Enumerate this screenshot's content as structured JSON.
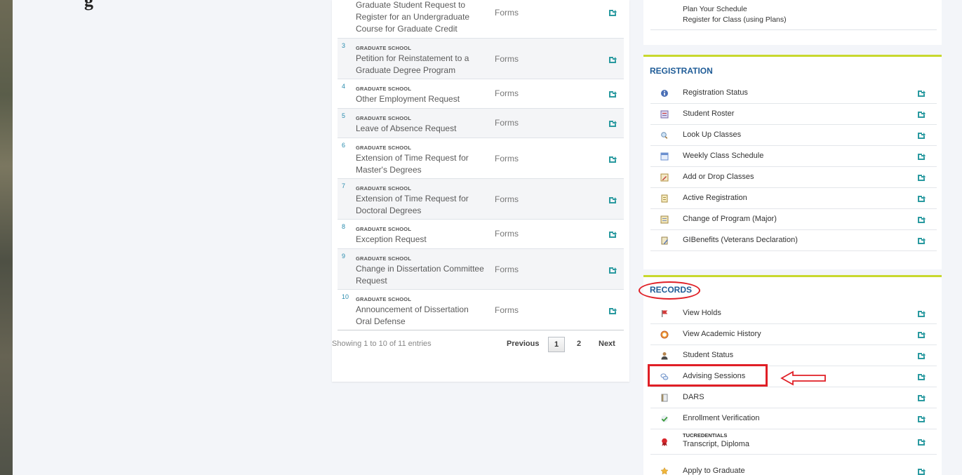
{
  "page_heading": "g",
  "forms": {
    "rows": [
      {
        "num": "",
        "school": "",
        "title": "Graduate Student Request to Register for an Undergraduate Course for Graduate Credit",
        "type": "Forms"
      },
      {
        "num": "3",
        "school": "GRADUATE SCHOOL",
        "title": "Petition for Reinstatement to a Graduate Degree Program",
        "type": "Forms"
      },
      {
        "num": "4",
        "school": "GRADUATE SCHOOL",
        "title": "Other Employment Request",
        "type": "Forms"
      },
      {
        "num": "5",
        "school": "GRADUATE SCHOOL",
        "title": "Leave of Absence Request",
        "type": "Forms"
      },
      {
        "num": "6",
        "school": "GRADUATE SCHOOL",
        "title": "Extension of Time Request for Master's Degrees",
        "type": "Forms"
      },
      {
        "num": "7",
        "school": "GRADUATE SCHOOL",
        "title": "Extension of Time Request for Doctoral Degrees",
        "type": "Forms"
      },
      {
        "num": "8",
        "school": "GRADUATE SCHOOL",
        "title": "Exception Request",
        "type": "Forms"
      },
      {
        "num": "9",
        "school": "GRADUATE SCHOOL",
        "title": "Change in Dissertation Committee Request",
        "type": "Forms"
      },
      {
        "num": "10",
        "school": "GRADUATE SCHOOL",
        "title": "Announcement of Dissertation Oral Defense",
        "type": "Forms"
      }
    ],
    "pager": {
      "info": "Showing 1 to 10 of 11 entries",
      "previous": "Previous",
      "page1": "1",
      "page2": "2",
      "next": "Next"
    }
  },
  "plans": {
    "line1": "Plan Your Schedule",
    "line2": "Register for Class (using Plans)"
  },
  "registration": {
    "title": "REGISTRATION",
    "items": [
      {
        "label": "Registration Status",
        "icon": "info-icon"
      },
      {
        "label": "Student Roster",
        "icon": "roster-icon"
      },
      {
        "label": "Look Up Classes",
        "icon": "magnifier-icon"
      },
      {
        "label": "Weekly Class Schedule",
        "icon": "calendar-icon"
      },
      {
        "label": "Add or Drop Classes",
        "icon": "edit-form-icon"
      },
      {
        "label": "Active Registration",
        "icon": "notepad-icon"
      },
      {
        "label": "Change of Program (Major)",
        "icon": "form-icon"
      },
      {
        "label": "GIBenefits (Veterans Declaration)",
        "icon": "document-pen-icon"
      }
    ]
  },
  "records": {
    "title": "RECORDS",
    "items": [
      {
        "label": "View Holds",
        "icon": "flag-icon"
      },
      {
        "label": "View Academic History",
        "icon": "history-icon"
      },
      {
        "label": "Student Status",
        "icon": "person-icon"
      },
      {
        "label": "Advising Sessions",
        "icon": "chat-bubbles-icon"
      },
      {
        "label": "DARS",
        "icon": "report-icon"
      },
      {
        "label": "Enrollment Verification",
        "icon": "checkmark-icon"
      },
      {
        "sub": "TUCREDENTIALS",
        "label": "Transcript, Diploma",
        "icon": "ribbon-icon"
      },
      {
        "label": "Apply to Graduate",
        "icon": "award-icon"
      }
    ]
  },
  "colors": {
    "accent_green": "#c8d82e",
    "title_blue": "#1f5c97",
    "annotation_red": "#e01f26",
    "link_teal": "#2a9aa0"
  }
}
